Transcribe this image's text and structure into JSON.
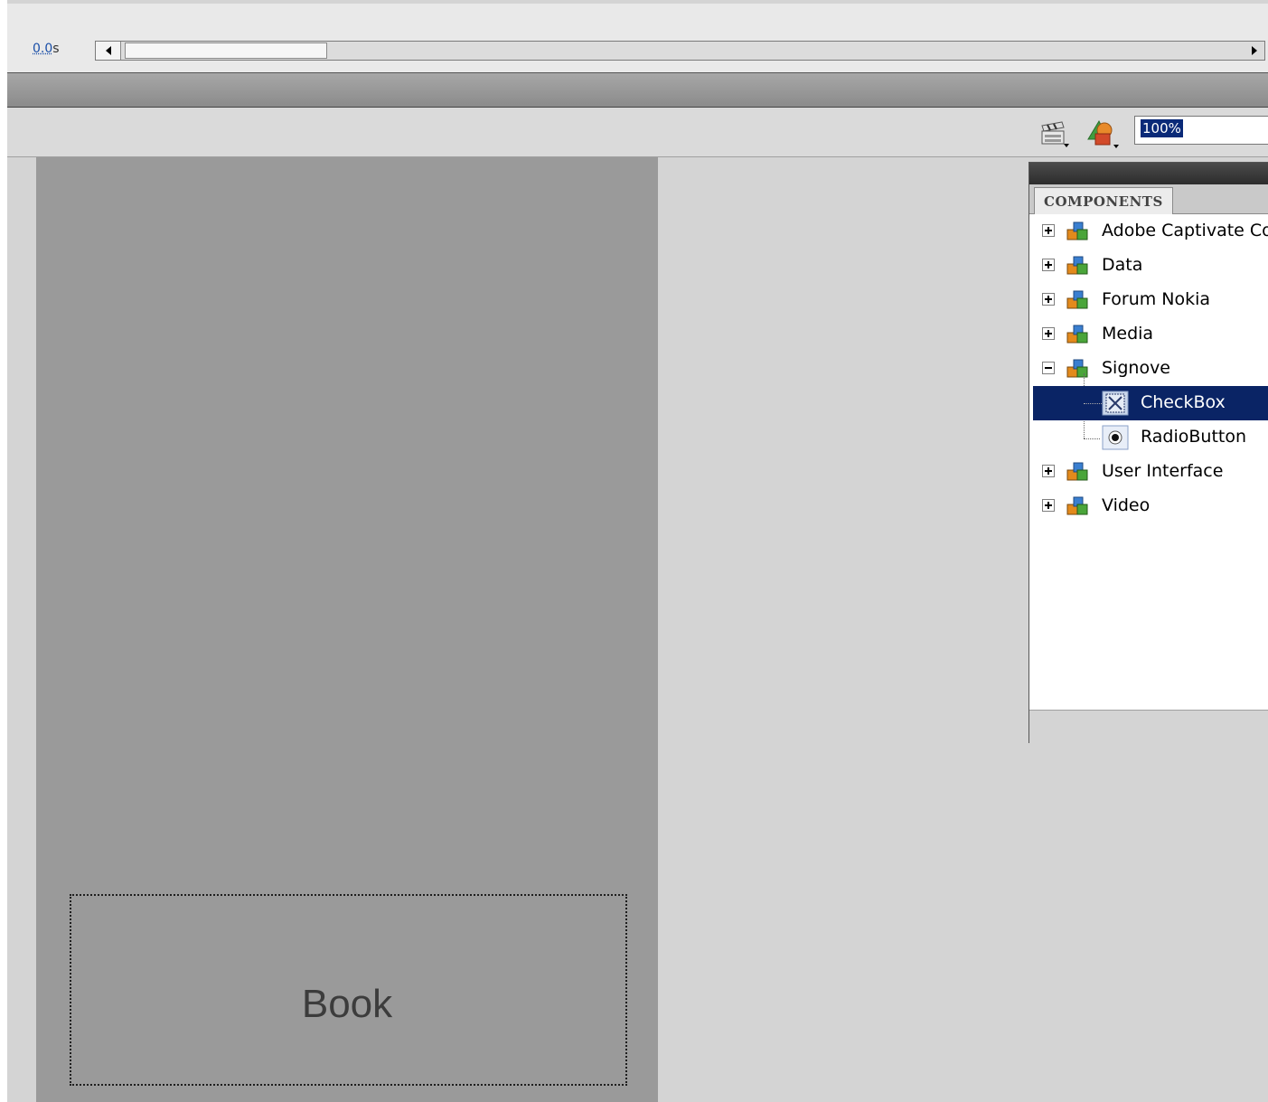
{
  "timeline": {
    "time_value": "0.0",
    "time_unit": "s"
  },
  "toolbar": {
    "zoom_value": "100%",
    "icons": [
      "edit-scene-icon",
      "edit-symbols-icon"
    ]
  },
  "stage": {
    "label": "Book"
  },
  "components_panel": {
    "tab_label": "COMPONENTS",
    "items": [
      {
        "label": "Adobe Captivate Co",
        "icon": "package-icon",
        "expanded": false
      },
      {
        "label": "Data",
        "icon": "package-icon",
        "expanded": false
      },
      {
        "label": "Forum Nokia",
        "icon": "package-icon",
        "expanded": false
      },
      {
        "label": "Media",
        "icon": "package-icon",
        "expanded": false
      },
      {
        "label": "Signove",
        "icon": "package-icon",
        "expanded": true,
        "children": [
          {
            "label": "CheckBox",
            "icon": "checkbox-component-icon",
            "selected": true
          },
          {
            "label": "RadioButton",
            "icon": "radiobutton-component-icon",
            "selected": false
          }
        ]
      },
      {
        "label": "User Interface",
        "icon": "package-icon",
        "expanded": false
      },
      {
        "label": "Video",
        "icon": "package-icon",
        "expanded": false
      }
    ]
  },
  "colors": {
    "selection": "#0a2465",
    "stage": "#9a9a9a",
    "workspace": "#d4d4d4"
  }
}
